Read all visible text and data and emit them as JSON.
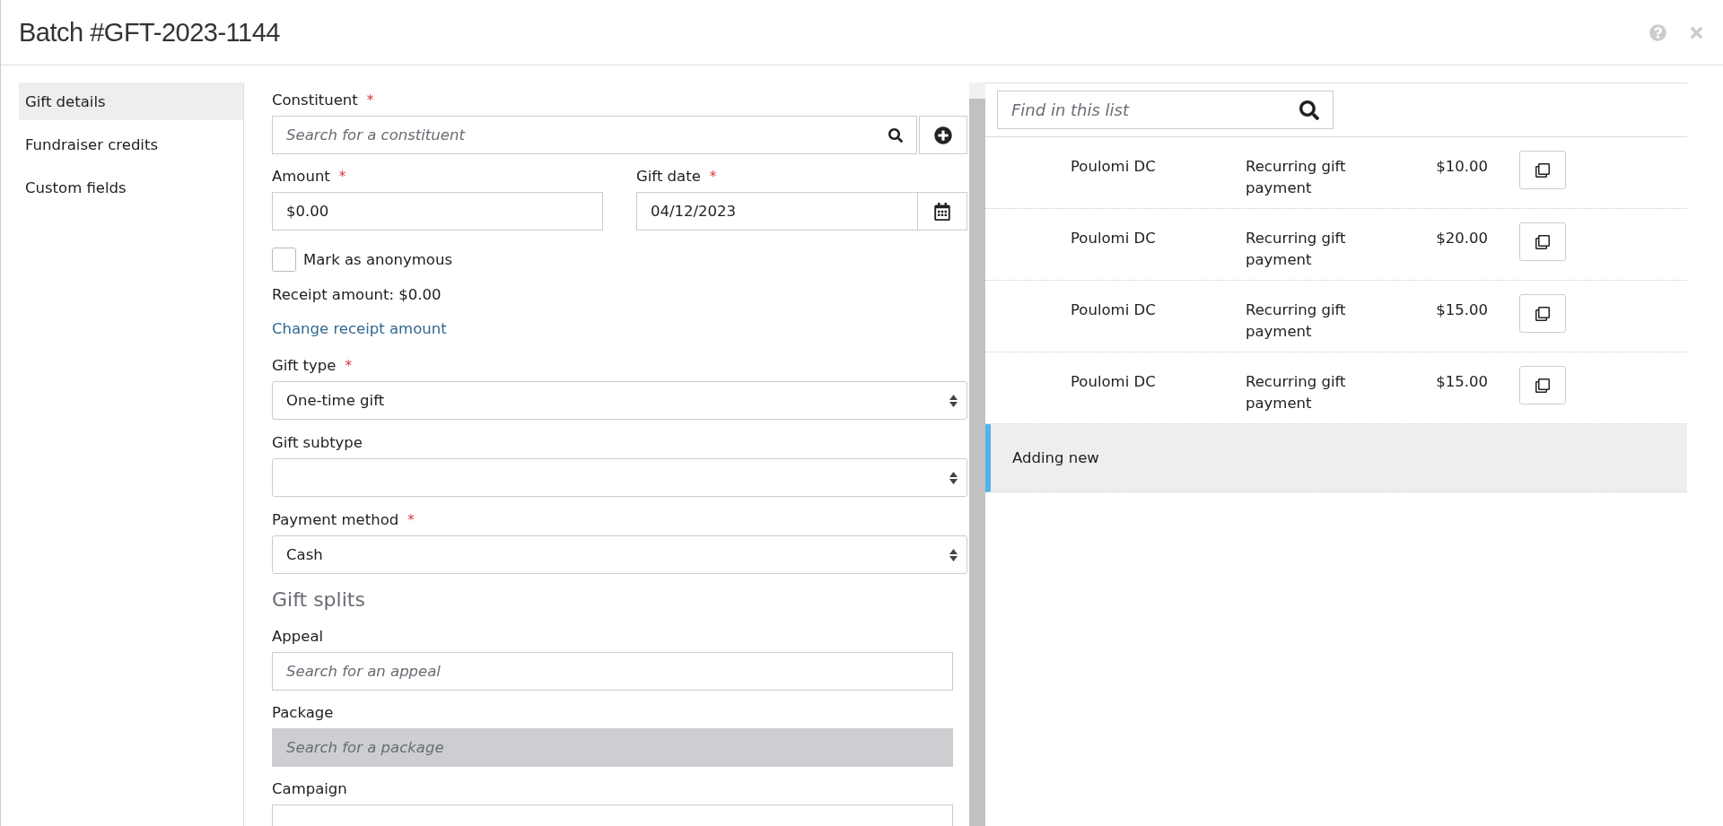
{
  "window": {
    "title": "Batch #GFT-2023-1144"
  },
  "sidebar": {
    "items": [
      {
        "label": "Gift details",
        "selected": true
      },
      {
        "label": "Fundraiser credits",
        "selected": false
      },
      {
        "label": "Custom fields",
        "selected": false
      }
    ]
  },
  "form": [
    {
      "kind": "lookup",
      "label": "Constituent",
      "required_mark": "*",
      "placeholder": "Search for a constituent",
      "disabled": false,
      "add_button": true
    },
    {
      "kind": "pair",
      "fields": [
        {
          "kind": "text",
          "label": "Amount",
          "required_mark": "*",
          "value": "$0.00"
        },
        {
          "kind": "date",
          "label": "Gift date",
          "required_mark": "*",
          "value": "04/12/2023"
        }
      ]
    },
    {
      "kind": "checkbox",
      "label": "Mark as anonymous",
      "checked": false
    },
    {
      "kind": "note",
      "text": "Receipt amount: $0.00"
    },
    {
      "kind": "link",
      "text": "Change receipt amount"
    },
    {
      "kind": "select",
      "label": "Gift type",
      "required_mark": "*",
      "value": "One-time gift"
    },
    {
      "kind": "select",
      "label": "Gift subtype"
    },
    {
      "kind": "select",
      "label": "Payment method",
      "required_mark": "*",
      "value": "Cash"
    },
    {
      "kind": "heading",
      "text": "Gift splits"
    },
    {
      "kind": "lookup",
      "label": "Appeal",
      "placeholder": "Search for an appeal",
      "disabled": false
    },
    {
      "kind": "lookup",
      "label": "Package",
      "placeholder": "Search for a package",
      "disabled": true
    },
    {
      "kind": "lookup",
      "label": "Campaign",
      "disabled": false
    }
  ],
  "list": {
    "search": {
      "placeholder": "Find in this list"
    },
    "rows": [
      {
        "name": "Poulomi DC",
        "type": "Recurring gift payment",
        "amount": "$10.00"
      },
      {
        "name": "Poulomi DC",
        "type": "Recurring gift payment",
        "amount": "$20.00"
      },
      {
        "name": "Poulomi DC",
        "type": "Recurring gift payment",
        "amount": "$15.00"
      },
      {
        "name": "Poulomi DC",
        "type": "Recurring gift payment",
        "amount": "$15.00"
      }
    ],
    "new_row": {
      "label": "Adding new",
      "selected": true
    }
  }
}
